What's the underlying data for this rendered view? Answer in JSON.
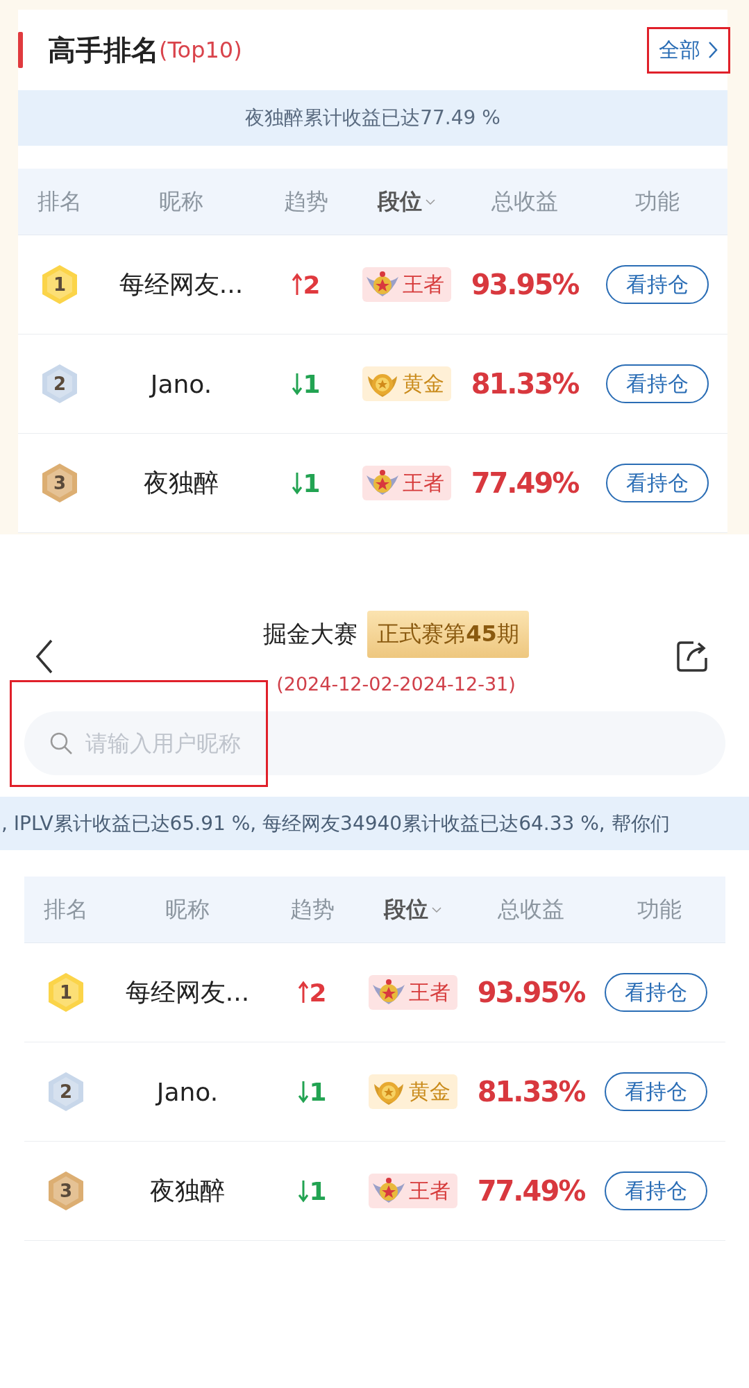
{
  "leaderboard_card": {
    "title": "高手排名",
    "title_suffix": "(Top10)",
    "all_link": {
      "label": "全部",
      "highlighted": true
    },
    "ticker": "夜独醉累计收益已达77.49 %",
    "columns": [
      {
        "label": "排名",
        "dropdown": false
      },
      {
        "label": "昵称",
        "dropdown": false
      },
      {
        "label": "趋势",
        "dropdown": false
      },
      {
        "label": "段位",
        "dropdown": true
      },
      {
        "label": "总收益",
        "dropdown": false
      },
      {
        "label": "功能",
        "dropdown": false
      }
    ],
    "rows": [
      {
        "rank": "1",
        "color": "#fbd449",
        "name": "每经网友...",
        "trend": {
          "kind": "up",
          "change": "2"
        },
        "tier": {
          "kind": "king",
          "label": "王者"
        },
        "return": "93.95%",
        "action": "看持仓"
      },
      {
        "rank": "2",
        "color": "#c8d7ea",
        "name": "Jano.",
        "trend": {
          "kind": "down",
          "change": "1"
        },
        "tier": {
          "kind": "gold",
          "label": "黄金"
        },
        "return": "81.33%",
        "action": "看持仓"
      },
      {
        "rank": "3",
        "color": "#dcae72",
        "name": "夜独醉",
        "trend": {
          "kind": "down",
          "change": "1"
        },
        "tier": {
          "kind": "king",
          "label": "王者"
        },
        "return": "77.49%",
        "action": "看持仓"
      }
    ]
  },
  "contest_page": {
    "title": "掘金大赛",
    "period_badge": "正式赛第**45**期",
    "date_range": "(2024-12-02-2024-12-31)",
    "search": {
      "placeholder": "请输入用户昵称",
      "highlighted": true
    },
    "ticker": ", IPLV累计收益已达65.91 %, 每经网友34940累计收益已达64.33 %, 帮你们",
    "columns": [
      {
        "label": "排名",
        "dropdown": false
      },
      {
        "label": "昵称",
        "dropdown": false
      },
      {
        "label": "趋势",
        "dropdown": false
      },
      {
        "label": "段位",
        "dropdown": true
      },
      {
        "label": "总收益",
        "dropdown": false
      },
      {
        "label": "功能",
        "dropdown": false
      }
    ],
    "rows": [
      {
        "rank": "1",
        "color": "#fbd449",
        "name": "每经网友...",
        "trend": {
          "kind": "up",
          "change": "2"
        },
        "tier": {
          "kind": "king",
          "label": "王者"
        },
        "return": "93.95%",
        "action": "看持仓"
      },
      {
        "rank": "2",
        "color": "#c8d7ea",
        "name": "Jano.",
        "trend": {
          "kind": "down",
          "change": "1"
        },
        "tier": {
          "kind": "gold",
          "label": "黄金"
        },
        "return": "81.33%",
        "action": "看持仓"
      },
      {
        "rank": "3",
        "color": "#dcae72",
        "name": "夜独醉",
        "trend": {
          "kind": "down",
          "change": "1"
        },
        "tier": {
          "kind": "king",
          "label": "王者"
        },
        "return": "77.49%",
        "action": "看持仓"
      }
    ]
  }
}
